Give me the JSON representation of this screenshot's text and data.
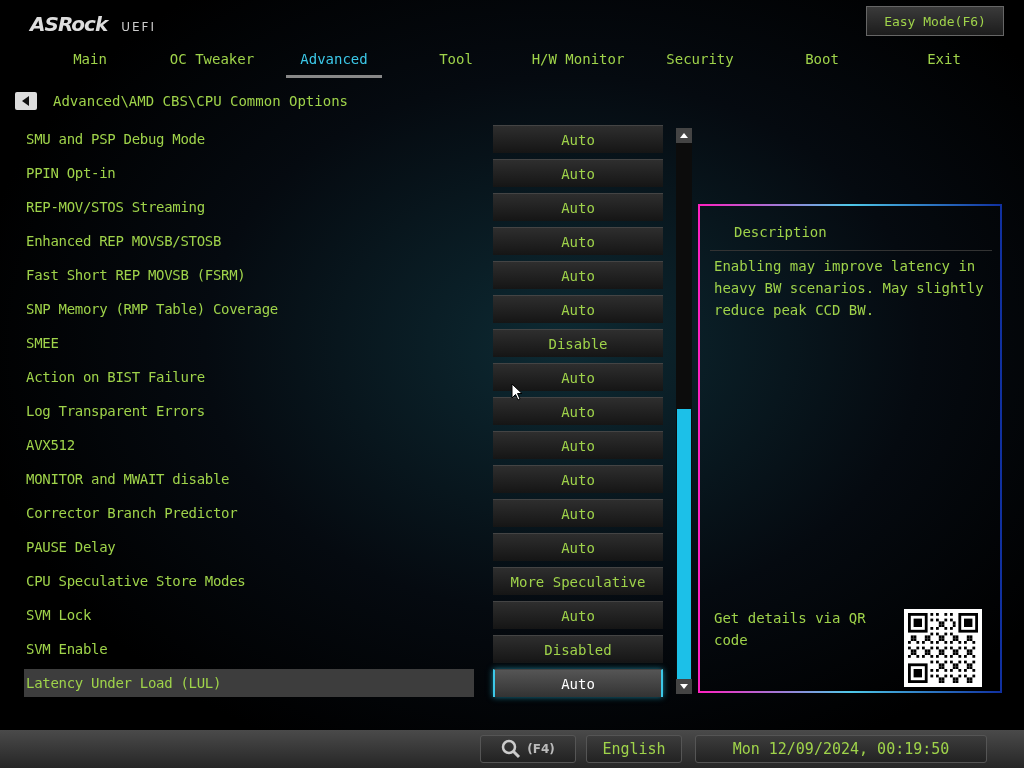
{
  "header": {
    "logo": "ASRock",
    "logo_suffix": "UEFI",
    "mode_button": "Easy Mode(F6)"
  },
  "tabs": [
    {
      "label": "Main",
      "selected": false
    },
    {
      "label": "OC Tweaker",
      "selected": false
    },
    {
      "label": "Advanced",
      "selected": true
    },
    {
      "label": "Tool",
      "selected": false
    },
    {
      "label": "H/W Monitor",
      "selected": false
    },
    {
      "label": "Security",
      "selected": false
    },
    {
      "label": "Boot",
      "selected": false
    },
    {
      "label": "Exit",
      "selected": false
    }
  ],
  "breadcrumb": "Advanced\\AMD CBS\\CPU Common Options",
  "settings": [
    {
      "label": "SMU and PSP Debug Mode",
      "value": "Auto",
      "selected": false
    },
    {
      "label": "PPIN Opt-in",
      "value": "Auto",
      "selected": false
    },
    {
      "label": "REP-MOV/STOS Streaming",
      "value": "Auto",
      "selected": false
    },
    {
      "label": "Enhanced REP MOVSB/STOSB",
      "value": "Auto",
      "selected": false
    },
    {
      "label": "Fast Short REP MOVSB (FSRM)",
      "value": "Auto",
      "selected": false
    },
    {
      "label": "SNP Memory (RMP Table) Coverage",
      "value": "Auto",
      "selected": false
    },
    {
      "label": "SMEE",
      "value": "Disable",
      "selected": false
    },
    {
      "label": "Action on BIST Failure",
      "value": "Auto",
      "selected": false
    },
    {
      "label": "Log Transparent Errors",
      "value": "Auto",
      "selected": false
    },
    {
      "label": "AVX512",
      "value": "Auto",
      "selected": false
    },
    {
      "label": "MONITOR and MWAIT disable",
      "value": "Auto",
      "selected": false
    },
    {
      "label": "Corrector Branch Predictor",
      "value": "Auto",
      "selected": false
    },
    {
      "label": "PAUSE Delay",
      "value": "Auto",
      "selected": false
    },
    {
      "label": "CPU Speculative Store Modes",
      "value": "More Speculative",
      "selected": false
    },
    {
      "label": "SVM Lock",
      "value": "Auto",
      "selected": false
    },
    {
      "label": "SVM Enable",
      "value": "Disabled",
      "selected": false
    },
    {
      "label": "Latency Under Load (LUL)",
      "value": "Auto",
      "selected": true
    }
  ],
  "description": {
    "title": "Description",
    "text": "Enabling may improve latency in heavy BW scenarios.  May slightly reduce peak CCD BW.",
    "qr_caption": "Get details via QR code"
  },
  "status_bar": {
    "search_key": "(F4)",
    "language": "English",
    "datetime": "Mon 12/09/2024, 00:19:50"
  }
}
